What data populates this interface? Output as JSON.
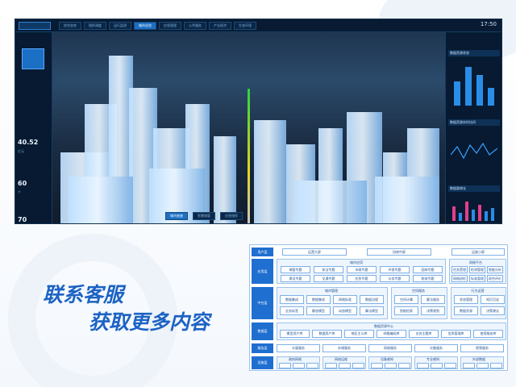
{
  "dashboard": {
    "tabs": [
      "综合态势",
      "指挥调度",
      "运行监测",
      "城市总览",
      "应急管理",
      "公共服务",
      "产业经济",
      "生态环境"
    ],
    "active_tab_index": 3,
    "clock": "17:50",
    "left_kpis": [
      {
        "value": "40.52",
        "label": "亿元"
      },
      {
        "value": "60",
        "label": "个"
      },
      {
        "value": "70",
        "label": "%"
      }
    ],
    "right_titles": [
      "数据资源状态",
      "数据资源实时访问",
      "数据量增长"
    ],
    "bottom_tabs": [
      "城市底座",
      "智慧城管",
      "应急指挥"
    ]
  },
  "cta": {
    "line1": "联系客服",
    "line2": "获取更多内容"
  },
  "architecture": {
    "row_labels": [
      "用户层",
      "应用层",
      "中台层",
      "数据层",
      "服务层",
      "设施层"
    ],
    "user_boxes": [
      "运营大屏",
      "协商中屏",
      "运维小屏"
    ],
    "app_group_title": "城市应用",
    "app_boxes": [
      "城管专题",
      "执法专题",
      "市政专题",
      "环保专题",
      "园林专题",
      "建设专题",
      "交通专题",
      "应急专题",
      "水务专题",
      "物流专题"
    ],
    "app_right_title": "网格平台",
    "app_right_boxes": [
      "任务受理",
      "检测管理",
      "智能分析",
      "网格巡检",
      "标准管理",
      "综合评价"
    ],
    "mid_groups": [
      "城市管理",
      "空间服务",
      "行为运营"
    ],
    "mid_boxes": [
      "数据集成",
      "数据集成",
      "网格标准",
      "数据治理",
      "空间计算",
      "算法服务",
      "状态管理",
      "知识沉淀",
      "业务标签",
      "静态模型",
      "动态模型",
      "算法模型",
      "智能检索",
      "决策规划",
      "数据资源",
      "决策建议"
    ],
    "data_group_title": "数据资源中心",
    "data_boxes": [
      "模型资产库",
      "数据资产库",
      "地区主义库",
      "网格编码库",
      "业务主题库",
      "信息管理库",
      "使用服务库"
    ],
    "service_boxes": [
      "计量服务",
      "存储服务",
      "网络服务",
      "灾备服务",
      "视频服务"
    ],
    "infra_groups": [
      "政府网格",
      "网络运维",
      "设备感知",
      "专业感知",
      "外部数据"
    ]
  }
}
